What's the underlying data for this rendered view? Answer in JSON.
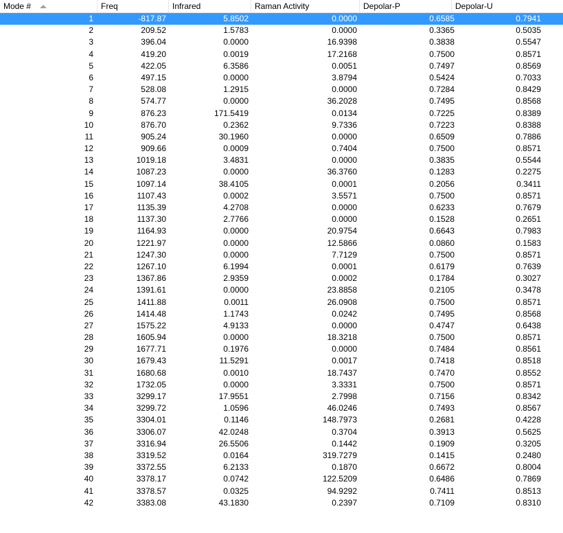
{
  "columns": [
    "Mode #",
    "Freq",
    "Infrared",
    "Raman Activity",
    "Depolar-P",
    "Depolar-U"
  ],
  "sort_indicator": "sort-ascending-icon",
  "selected_row": 0,
  "selection_color": "#3399ff",
  "rows": [
    [
      "1",
      "-817.87",
      "5.8502",
      "0.0000",
      "0.6585",
      "0.7941"
    ],
    [
      "2",
      "209.52",
      "1.5783",
      "0.0000",
      "0.3365",
      "0.5035"
    ],
    [
      "3",
      "396.04",
      "0.0000",
      "16.9398",
      "0.3838",
      "0.5547"
    ],
    [
      "4",
      "419.20",
      "0.0019",
      "17.2168",
      "0.7500",
      "0.8571"
    ],
    [
      "5",
      "422.05",
      "6.3586",
      "0.0051",
      "0.7497",
      "0.8569"
    ],
    [
      "6",
      "497.15",
      "0.0000",
      "3.8794",
      "0.5424",
      "0.7033"
    ],
    [
      "7",
      "528.08",
      "1.2915",
      "0.0000",
      "0.7284",
      "0.8429"
    ],
    [
      "8",
      "574.77",
      "0.0000",
      "36.2028",
      "0.7495",
      "0.8568"
    ],
    [
      "9",
      "876.23",
      "171.5419",
      "0.0134",
      "0.7225",
      "0.8389"
    ],
    [
      "10",
      "876.70",
      "0.2362",
      "9.7336",
      "0.7223",
      "0.8388"
    ],
    [
      "11",
      "905.24",
      "30.1960",
      "0.0000",
      "0.6509",
      "0.7886"
    ],
    [
      "12",
      "909.66",
      "0.0009",
      "0.7404",
      "0.7500",
      "0.8571"
    ],
    [
      "13",
      "1019.18",
      "3.4831",
      "0.0000",
      "0.3835",
      "0.5544"
    ],
    [
      "14",
      "1087.23",
      "0.0000",
      "36.3760",
      "0.1283",
      "0.2275"
    ],
    [
      "15",
      "1097.14",
      "38.4105",
      "0.0001",
      "0.2056",
      "0.3411"
    ],
    [
      "16",
      "1107.43",
      "0.0002",
      "3.5571",
      "0.7500",
      "0.8571"
    ],
    [
      "17",
      "1135.39",
      "4.2708",
      "0.0000",
      "0.6233",
      "0.7679"
    ],
    [
      "18",
      "1137.30",
      "2.7766",
      "0.0000",
      "0.1528",
      "0.2651"
    ],
    [
      "19",
      "1164.93",
      "0.0000",
      "20.9754",
      "0.6643",
      "0.7983"
    ],
    [
      "20",
      "1221.97",
      "0.0000",
      "12.5866",
      "0.0860",
      "0.1583"
    ],
    [
      "21",
      "1247.30",
      "0.0000",
      "7.7129",
      "0.7500",
      "0.8571"
    ],
    [
      "22",
      "1267.10",
      "6.1994",
      "0.0001",
      "0.6179",
      "0.7639"
    ],
    [
      "23",
      "1367.86",
      "2.9359",
      "0.0002",
      "0.1784",
      "0.3027"
    ],
    [
      "24",
      "1391.61",
      "0.0000",
      "23.8858",
      "0.2105",
      "0.3478"
    ],
    [
      "25",
      "1411.88",
      "0.0011",
      "26.0908",
      "0.7500",
      "0.8571"
    ],
    [
      "26",
      "1414.48",
      "1.1743",
      "0.0242",
      "0.7495",
      "0.8568"
    ],
    [
      "27",
      "1575.22",
      "4.9133",
      "0.0000",
      "0.4747",
      "0.6438"
    ],
    [
      "28",
      "1605.94",
      "0.0000",
      "18.3218",
      "0.7500",
      "0.8571"
    ],
    [
      "29",
      "1677.71",
      "0.1976",
      "0.0000",
      "0.7484",
      "0.8561"
    ],
    [
      "30",
      "1679.43",
      "11.5291",
      "0.0017",
      "0.7418",
      "0.8518"
    ],
    [
      "31",
      "1680.68",
      "0.0010",
      "18.7437",
      "0.7470",
      "0.8552"
    ],
    [
      "32",
      "1732.05",
      "0.0000",
      "3.3331",
      "0.7500",
      "0.8571"
    ],
    [
      "33",
      "3299.17",
      "17.9551",
      "2.7998",
      "0.7156",
      "0.8342"
    ],
    [
      "34",
      "3299.72",
      "1.0596",
      "46.0246",
      "0.7493",
      "0.8567"
    ],
    [
      "35",
      "3304.01",
      "0.1146",
      "148.7973",
      "0.2681",
      "0.4228"
    ],
    [
      "36",
      "3306.07",
      "42.0248",
      "0.3704",
      "0.3913",
      "0.5625"
    ],
    [
      "37",
      "3316.94",
      "26.5506",
      "0.1442",
      "0.1909",
      "0.3205"
    ],
    [
      "38",
      "3319.52",
      "0.0164",
      "319.7279",
      "0.1415",
      "0.2480"
    ],
    [
      "39",
      "3372.55",
      "6.2133",
      "0.1870",
      "0.6672",
      "0.8004"
    ],
    [
      "40",
      "3378.17",
      "0.0742",
      "122.5209",
      "0.6486",
      "0.7869"
    ],
    [
      "41",
      "3378.57",
      "0.0325",
      "94.9292",
      "0.7411",
      "0.8513"
    ],
    [
      "42",
      "3383.08",
      "43.1830",
      "0.2397",
      "0.7109",
      "0.8310"
    ]
  ]
}
